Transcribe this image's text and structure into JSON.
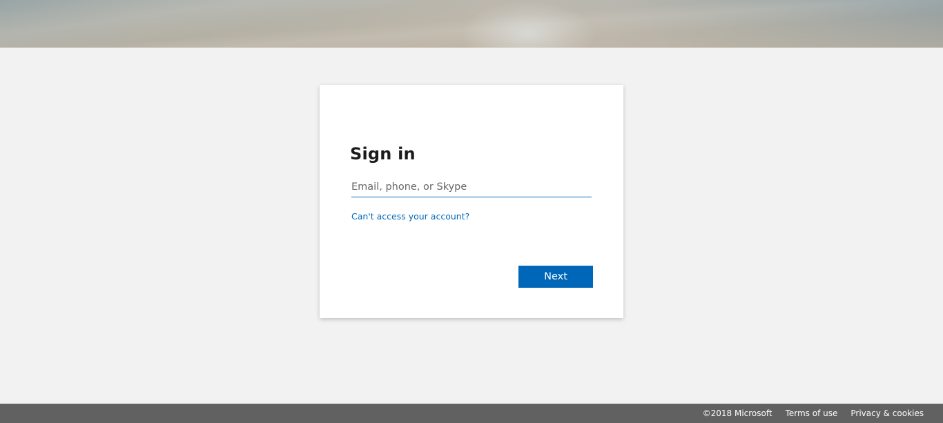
{
  "sign_in": {
    "title": "Sign in",
    "email_placeholder": "Email, phone, or Skype",
    "email_value": "",
    "cant_access_label": "Can't access your account?",
    "next_label": "Next"
  },
  "footer": {
    "copyright": "©2018 Microsoft",
    "terms_label": "Terms of use",
    "privacy_label": "Privacy & cookies"
  },
  "colors": {
    "accent": "#0067b8",
    "page_background": "#f2f2f2",
    "footer_background": "#616161"
  }
}
